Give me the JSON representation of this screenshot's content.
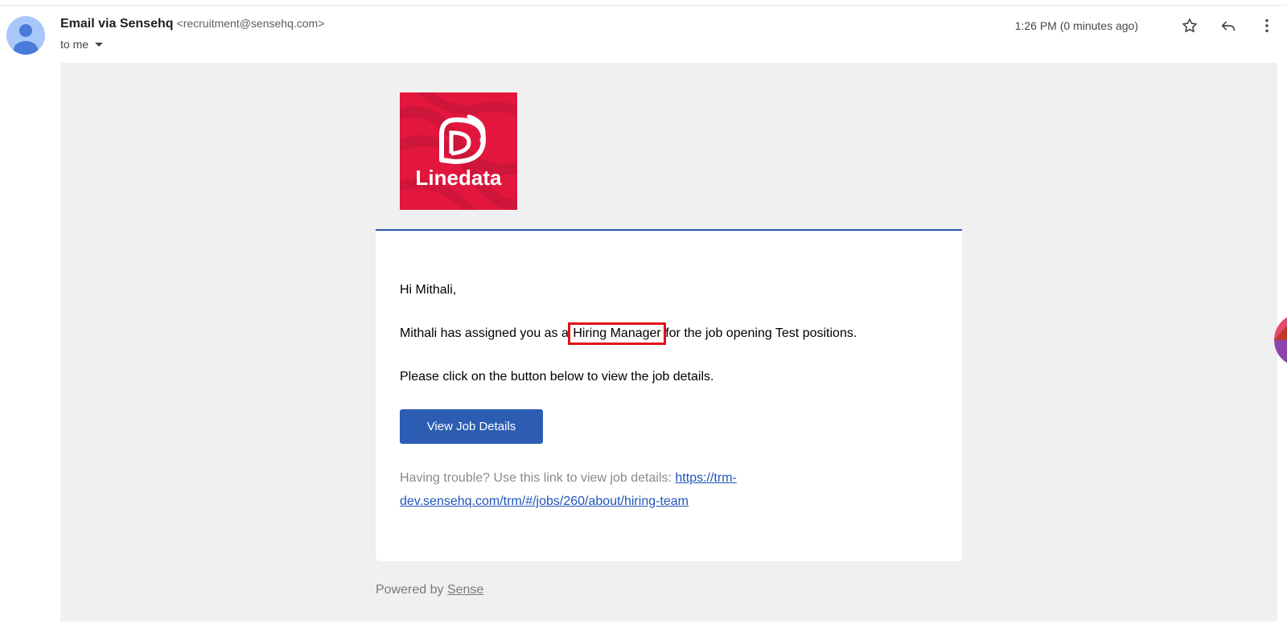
{
  "header": {
    "sender_name": "Email via Sensehq",
    "sender_email": "<recruitment@sensehq.com>",
    "recipient": "to me",
    "timestamp": "1:26 PM (0 minutes ago)"
  },
  "icons": {
    "avatar": "person-avatar-icon",
    "star": "star-icon",
    "reply": "reply-icon",
    "more": "more-vert-icon",
    "recipient_dropdown": "chevron-down-icon"
  },
  "logo": {
    "text": "Linedata",
    "background_color": "#e3173e"
  },
  "body": {
    "greeting": "Hi Mithali,",
    "assign_prefix": "Mithali has assigned you as a",
    "role": "Hiring Manager",
    "assign_suffix": "for the job opening Test positions.",
    "instruction": "Please click on the button below to view the job details.",
    "button_label": "View Job Details",
    "trouble_text": "Having trouble? Use this link to view job details:",
    "job_link": "https://trm-dev.sensehq.com/trm/#/jobs/260/about/hiring-team"
  },
  "footer": {
    "powered_by": "Powered by",
    "brand_link": "Sense"
  },
  "colors": {
    "button": "#2c5db3",
    "card_border": "#2957b0",
    "highlight": "#e3101b",
    "frame_background": "#f0f0f0"
  }
}
